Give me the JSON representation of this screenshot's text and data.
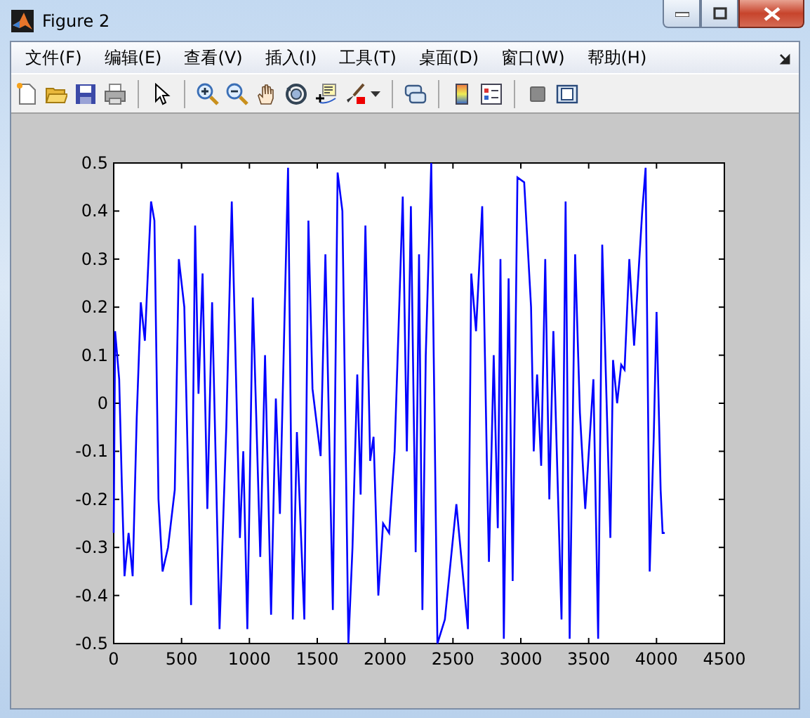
{
  "window": {
    "title": "Figure 2"
  },
  "menu": [
    "文件(F)",
    "编辑(E)",
    "查看(V)",
    "插入(I)",
    "工具(T)",
    "桌面(D)",
    "窗口(W)",
    "帮助(H)"
  ],
  "figure": {
    "chart_data": {
      "type": "line",
      "x": [
        0,
        10,
        40,
        60,
        80,
        110,
        140,
        170,
        200,
        230,
        275,
        300,
        330,
        360,
        400,
        450,
        480,
        520,
        570,
        600,
        625,
        655,
        690,
        725,
        780,
        830,
        870,
        930,
        955,
        985,
        1025,
        1080,
        1115,
        1160,
        1195,
        1225,
        1285,
        1320,
        1350,
        1405,
        1435,
        1465,
        1525,
        1560,
        1615,
        1650,
        1685,
        1730,
        1760,
        1795,
        1820,
        1855,
        1890,
        1915,
        1950,
        1985,
        2030,
        2070,
        2130,
        2160,
        2190,
        2225,
        2250,
        2275,
        2300,
        2340,
        2385,
        2440,
        2525,
        2610,
        2635,
        2670,
        2715,
        2750,
        2765,
        2800,
        2830,
        2850,
        2875,
        2910,
        2940,
        2975,
        3025,
        3075,
        3095,
        3120,
        3150,
        3180,
        3210,
        3240,
        3300,
        3330,
        3360,
        3400,
        3435,
        3475,
        3535,
        3570,
        3600,
        3660,
        3680,
        3710,
        3740,
        3765,
        3800,
        3835,
        3895,
        3920,
        3950,
        3980,
        4000,
        4030,
        4045,
        4060
      ],
      "series": [
        {
          "color": "#0000ff",
          "values": [
            -0.27,
            0.15,
            0.05,
            -0.17,
            -0.36,
            -0.27,
            -0.36,
            -0.03,
            0.21,
            0.13,
            0.42,
            0.38,
            -0.2,
            -0.35,
            -0.3,
            -0.18,
            0.3,
            0.2,
            -0.42,
            0.37,
            0.02,
            0.27,
            -0.22,
            0.21,
            -0.47,
            -0.05,
            0.42,
            -0.28,
            -0.1,
            -0.47,
            0.22,
            -0.32,
            0.1,
            -0.44,
            0.01,
            -0.23,
            0.49,
            -0.45,
            -0.06,
            -0.45,
            0.38,
            0.03,
            -0.11,
            0.31,
            -0.43,
            0.48,
            0.4,
            -0.5,
            -0.3,
            0.06,
            -0.19,
            0.37,
            -0.12,
            -0.07,
            -0.4,
            -0.25,
            -0.27,
            -0.1,
            0.43,
            -0.1,
            0.41,
            -0.31,
            0.31,
            -0.43,
            0.1,
            0.5,
            -0.5,
            -0.45,
            -0.21,
            -0.47,
            0.27,
            0.15,
            0.41,
            -0.12,
            -0.33,
            0.1,
            -0.26,
            0.3,
            -0.49,
            0.26,
            -0.37,
            0.47,
            0.46,
            0.2,
            -0.1,
            0.06,
            -0.13,
            0.3,
            -0.2,
            0.15,
            -0.45,
            0.42,
            -0.49,
            0.31,
            -0.02,
            -0.22,
            0.05,
            -0.49,
            0.33,
            -0.28,
            0.09,
            0,
            0.08,
            0.07,
            0.3,
            0.12,
            0.4,
            0.49,
            -0.35,
            -0.07,
            0.19,
            -0.18,
            -0.27,
            -0.27
          ]
        }
      ],
      "xlim": [
        0,
        4500
      ],
      "ylim": [
        -0.5,
        0.5
      ],
      "xticks": [
        0,
        500,
        1000,
        1500,
        2000,
        2500,
        3000,
        3500,
        4000,
        4500
      ],
      "yticks": [
        -0.5,
        -0.4,
        -0.3,
        -0.2,
        -0.1,
        0,
        0.1,
        0.2,
        0.3,
        0.4,
        0.5
      ]
    }
  }
}
